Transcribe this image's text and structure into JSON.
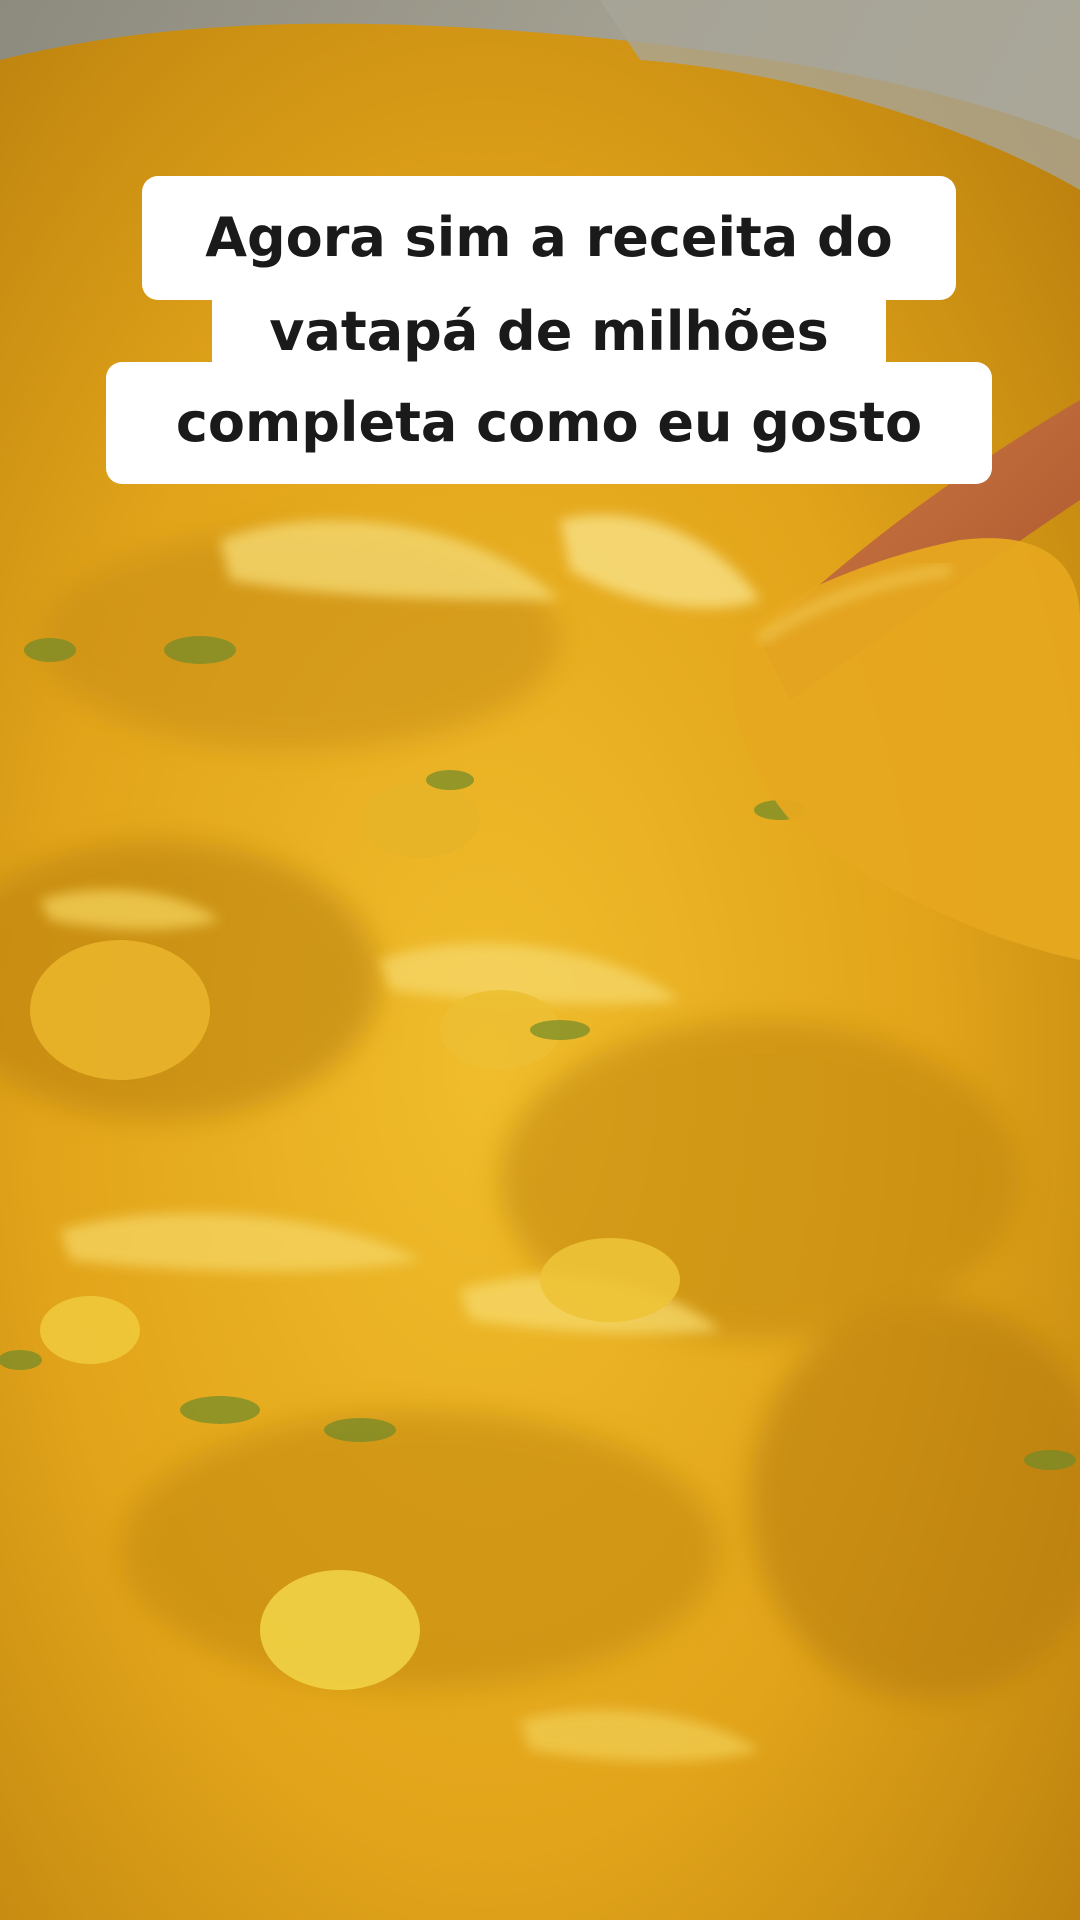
{
  "caption": {
    "lines": [
      "Agora sim a receita do",
      "vatapá de milhões",
      "completa como eu gosto"
    ]
  },
  "colors": {
    "sauce": "#e3a51c",
    "sauce_highlight": "#f4d35a",
    "sauce_shadow": "#b47a0c",
    "pot_rim": "#9d9a8c",
    "spoon": "#c46a3a",
    "herb": "#6f8a2a"
  }
}
